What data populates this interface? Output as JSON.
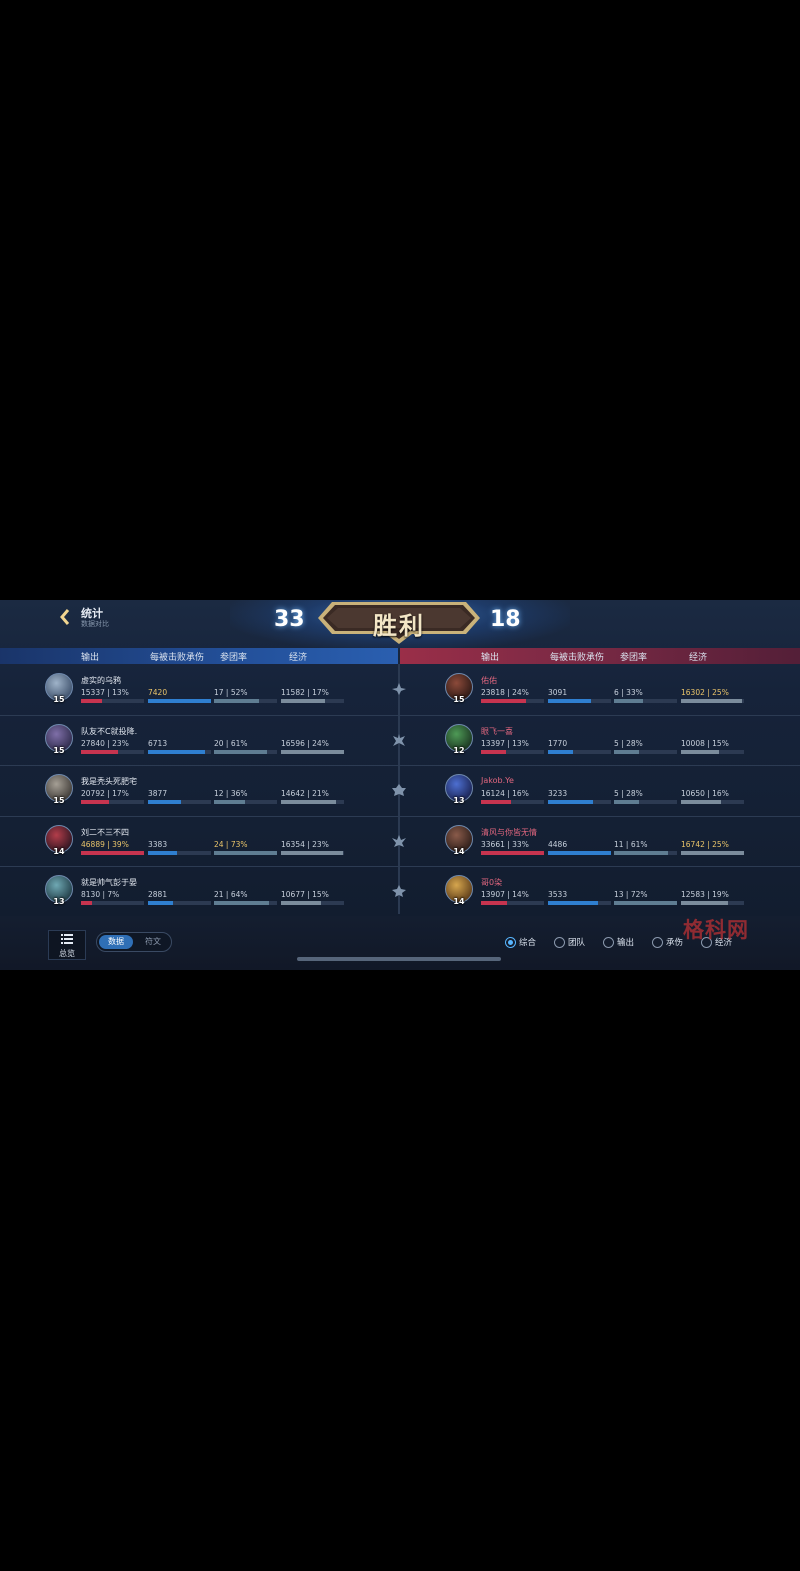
{
  "header": {
    "title": "统计",
    "subtitle": "数据对比",
    "result": "胜利",
    "score_left": "33",
    "score_right": "18"
  },
  "columns": {
    "output": "输出",
    "tank": "每被击败承伤",
    "participation": "参团率",
    "gold": "经济"
  },
  "team_left": [
    {
      "name": "虚实的乌鸦",
      "level": "15",
      "output": "15337 | 13%",
      "tank": "7420",
      "participation": "17 | 52%",
      "gold": "11582 | 17%",
      "output_pct": 0.34,
      "tank_pct": 1.0,
      "part_pct": 0.72,
      "gold_pct": 0.7,
      "tank_hl": true
    },
    {
      "name": "队友不C就投降.",
      "level": "15",
      "output": "27840 | 23%",
      "tank": "6713",
      "participation": "20 | 61%",
      "gold": "16596 | 24%",
      "output_pct": 0.59,
      "tank_pct": 0.9,
      "part_pct": 0.84,
      "gold_pct": 1.0
    },
    {
      "name": "我是秃头死肥宅",
      "level": "15",
      "output": "20792 | 17%",
      "tank": "3877",
      "participation": "12 | 36%",
      "gold": "14642 | 21%",
      "output_pct": 0.44,
      "tank_pct": 0.52,
      "part_pct": 0.49,
      "gold_pct": 0.88
    },
    {
      "name": "刘二不三不四",
      "level": "14",
      "output": "46889 | 39%",
      "tank": "3383",
      "participation": "24 | 73%",
      "gold": "16354 | 23%",
      "output_pct": 1.0,
      "tank_pct": 0.46,
      "part_pct": 1.0,
      "gold_pct": 0.98,
      "output_hl": true,
      "part_hl": true
    },
    {
      "name": "就是帅气彭于晏",
      "level": "13",
      "output": "8130 | 7%",
      "tank": "2881",
      "participation": "21 | 64%",
      "gold": "10677 | 15%",
      "output_pct": 0.17,
      "tank_pct": 0.39,
      "part_pct": 0.88,
      "gold_pct": 0.64
    }
  ],
  "team_right": [
    {
      "name": "佑佑",
      "level": "15",
      "output": "23818 | 24%",
      "tank": "3091",
      "participation": "6 | 33%",
      "gold": "16302 | 25%",
      "output_pct": 0.71,
      "tank_pct": 0.69,
      "part_pct": 0.46,
      "gold_pct": 0.97,
      "gold_hl": true
    },
    {
      "name": "眼飞一喜",
      "level": "12",
      "output": "13397 | 13%",
      "tank": "1770",
      "participation": "5 | 28%",
      "gold": "10008 | 15%",
      "output_pct": 0.4,
      "tank_pct": 0.39,
      "part_pct": 0.39,
      "gold_pct": 0.6
    },
    {
      "name": "Jakob.Ye",
      "level": "13",
      "output": "16124 | 16%",
      "tank": "3233",
      "participation": "5 | 28%",
      "gold": "10650 | 16%",
      "output_pct": 0.48,
      "tank_pct": 0.72,
      "part_pct": 0.39,
      "gold_pct": 0.64
    },
    {
      "name": "清风与你皆无情",
      "level": "14",
      "output": "33661 | 33%",
      "tank": "4486",
      "participation": "11 | 61%",
      "gold": "16742 | 25%",
      "output_pct": 1.0,
      "tank_pct": 1.0,
      "part_pct": 0.85,
      "gold_pct": 1.0,
      "gold_hl": true
    },
    {
      "name": "哥0染",
      "level": "14",
      "output": "13907 | 14%",
      "tank": "3533",
      "participation": "13 | 72%",
      "gold": "12583 | 19%",
      "output_pct": 0.41,
      "tank_pct": 0.79,
      "part_pct": 1.0,
      "gold_pct": 0.75
    }
  ],
  "bottom": {
    "overview_label": "总览",
    "toggle_on": "数据",
    "toggle_off": "符文",
    "radios": [
      "综合",
      "团队",
      "输出",
      "承伤",
      "经济"
    ],
    "selected_radio": "综合",
    "watermark": "格科网"
  },
  "colors": {
    "blue_team": "#2a5fb0",
    "red_team": "#9a2e48",
    "highlight": "#e9c46a",
    "accent": "#58b6ff"
  }
}
